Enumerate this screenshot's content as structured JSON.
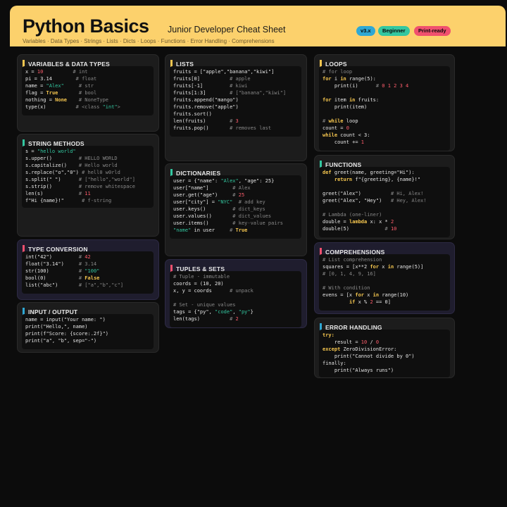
{
  "header": {
    "title": "Python Basics",
    "subtitle": "Junior Developer Cheat Sheet",
    "topics": "Variables · Data Types · Strings · Lists · Dicts · Loops · Functions · Error Handling · Comprehensions",
    "badges": [
      {
        "label": "v3.x",
        "color": "#2fa8d4"
      },
      {
        "label": "Beginner",
        "color": "#33c7a0"
      },
      {
        "label": "Print-ready",
        "color": "#f0506e"
      }
    ]
  },
  "colors": {
    "accent_yellow": "#f5c64f",
    "accent_green": "#33c7a0",
    "accent_pink": "#f0506e",
    "accent_blue": "#2fa8d4",
    "header_bg": "#fcd16c"
  },
  "cards": {
    "variables": {
      "title": "VARIABLES & DATA TYPES"
    },
    "strings": {
      "title": "STRING METHODS"
    },
    "conversion": {
      "title": "TYPE CONVERSION"
    },
    "io": {
      "title": "INPUT / OUTPUT"
    },
    "lists": {
      "title": "LISTS"
    },
    "dicts": {
      "title": "DICTIONARIES"
    },
    "tuples": {
      "title": "TUPLES & SETS"
    },
    "loops": {
      "title": "LOOPS"
    },
    "functions": {
      "title": "FUNCTIONS"
    },
    "comprehensions": {
      "title": "COMPREHENSIONS"
    },
    "errors": {
      "title": "ERROR HANDLING"
    }
  },
  "code": {
    "variables": [
      [
        [
          "x = ",
          ""
        ],
        [
          "10",
          "n"
        ],
        [
          "          ",
          ""
        ],
        [
          "# int",
          "c"
        ]
      ],
      [
        [
          "pi = 3.14        ",
          ""
        ],
        [
          "# float",
          "c"
        ]
      ],
      [
        [
          "name = ",
          ""
        ],
        [
          "\"Alex\"",
          "s"
        ],
        [
          "     ",
          ""
        ],
        [
          "# str",
          "c"
        ]
      ],
      [
        [
          "flag = ",
          ""
        ],
        [
          "True",
          "k"
        ],
        [
          "       ",
          ""
        ],
        [
          "# bool",
          "c"
        ]
      ],
      [
        [
          "nothing = ",
          ""
        ],
        [
          "None",
          "k"
        ],
        [
          "    ",
          ""
        ],
        [
          "# NoneType",
          "c"
        ]
      ],
      [
        [
          "type(x)          ",
          ""
        ],
        [
          "# <class ",
          "c"
        ],
        [
          "\"int\"",
          "s"
        ],
        [
          ">",
          "c"
        ]
      ]
    ],
    "strings": [
      [
        [
          "s = ",
          ""
        ],
        [
          "\"hello world\"",
          "s"
        ]
      ],
      [
        [
          "s.upper()         ",
          ""
        ],
        [
          "# HELLO WORLD",
          "c"
        ]
      ],
      [
        [
          "s.capitalize()    ",
          ""
        ],
        [
          "# Hello world",
          "c"
        ]
      ],
      [
        [
          "s.replace(\"o\",\"0\") ",
          ""
        ],
        [
          "# hell0 w0rld",
          "c"
        ]
      ],
      [
        [
          "s.split(\" \")      ",
          ""
        ],
        [
          "# [\"hello\",\"world\"]",
          "c"
        ]
      ],
      [
        [
          "s.strip()         ",
          ""
        ],
        [
          "# remove whitespace",
          "c"
        ]
      ],
      [
        [
          "len(s)            ",
          ""
        ],
        [
          "# ",
          "c"
        ],
        [
          "11",
          "n"
        ]
      ],
      [
        [
          "f\"Hi {name}!\"      ",
          ""
        ],
        [
          "# f-string",
          "c"
        ]
      ]
    ],
    "conversion": [
      [
        [
          "int(\"42\")         ",
          ""
        ],
        [
          "# ",
          "c"
        ],
        [
          "42",
          "n"
        ]
      ],
      [
        [
          "float(\"3.14\")     ",
          ""
        ],
        [
          "# 3.14",
          "c"
        ]
      ],
      [
        [
          "str(100)          ",
          ""
        ],
        [
          "# ",
          "c"
        ],
        [
          "\"100\"",
          "s"
        ]
      ],
      [
        [
          "bool(0)           ",
          ""
        ],
        [
          "# ",
          "c"
        ],
        [
          "False",
          "k"
        ]
      ],
      [
        [
          "list(\"abc\")       ",
          ""
        ],
        [
          "# [\"a\",\"b\",\"c\"]",
          "c"
        ]
      ]
    ],
    "io": [
      [
        [
          "name = input(\"Your name: \")",
          ""
        ]
      ],
      [
        [
          "print(\"Hello,\", name)",
          ""
        ]
      ],
      [
        [
          "print(f\"Score: {score:.2f}\")",
          ""
        ]
      ],
      [
        [
          "print(\"a\", \"b\", sep=\"-\")",
          ""
        ]
      ]
    ],
    "lists": [
      [
        [
          "fruits = [\"apple\",\"banana\",\"kiwi\"]",
          ""
        ]
      ],
      [
        [
          "fruits[0]          ",
          ""
        ],
        [
          "# apple",
          "c"
        ]
      ],
      [
        [
          "fruits[-1]         ",
          ""
        ],
        [
          "# kiwi",
          "c"
        ]
      ],
      [
        [
          "fruits[1:3]        ",
          ""
        ],
        [
          "# [\"banana\",\"kiwi\"]",
          "c"
        ]
      ],
      [
        [
          "fruits.append(\"mango\")",
          ""
        ]
      ],
      [
        [
          "fruits.remove(\"apple\")",
          ""
        ]
      ],
      [
        [
          "fruits.sort()",
          ""
        ]
      ],
      [
        [
          "len(fruits)        ",
          ""
        ],
        [
          "# ",
          "c"
        ],
        [
          "3",
          "n"
        ]
      ],
      [
        [
          "fruits.pop()       ",
          ""
        ],
        [
          "# removes last",
          "c"
        ]
      ]
    ],
    "dicts": [
      [
        [
          "user = {\"name\": ",
          ""
        ],
        [
          "\"Alex\"",
          "s"
        ],
        [
          ", \"age\": 25}",
          ""
        ]
      ],
      [
        [
          "user[\"name\"]        ",
          ""
        ],
        [
          "# Alex",
          "c"
        ]
      ],
      [
        [
          "user.get(\"age\")     ",
          ""
        ],
        [
          "# ",
          "c"
        ],
        [
          "25",
          "n"
        ]
      ],
      [
        [
          "user[\"city\"] = ",
          ""
        ],
        [
          "\"NYC\"",
          "s"
        ],
        [
          "  ",
          ""
        ],
        [
          "# add key",
          "c"
        ]
      ],
      [
        [
          "user.keys()         ",
          ""
        ],
        [
          "# dict_keys",
          "c"
        ]
      ],
      [
        [
          "user.values()       ",
          ""
        ],
        [
          "# dict_values",
          "c"
        ]
      ],
      [
        [
          "user.items()        ",
          ""
        ],
        [
          "# key-value pairs",
          "c"
        ]
      ],
      [
        [
          "\"name\"",
          "s"
        ],
        [
          " in user     ",
          ""
        ],
        [
          "# ",
          "c"
        ],
        [
          "True",
          "k"
        ]
      ]
    ],
    "tuples": [
      [
        [
          "# Tuple - immutable",
          "c"
        ]
      ],
      [
        [
          "coords = (10, 20)",
          ""
        ]
      ],
      [
        [
          "x, y = coords      ",
          ""
        ],
        [
          "# unpack",
          "c"
        ]
      ],
      [
        [
          "",
          ""
        ]
      ],
      [
        [
          "# Set - unique values",
          "c"
        ]
      ],
      [
        [
          "tags = {\"py\", ",
          ""
        ],
        [
          "\"code\"",
          "s"
        ],
        [
          ", ",
          ""
        ],
        [
          "\"py\"",
          "s"
        ],
        [
          "}",
          ""
        ]
      ],
      [
        [
          "len(tags)          ",
          ""
        ],
        [
          "# ",
          "c"
        ],
        [
          "2",
          "n"
        ]
      ]
    ],
    "loops": [
      [
        [
          "# for loop",
          "c"
        ]
      ],
      [
        [
          "for",
          "k"
        ],
        [
          " i ",
          ""
        ],
        [
          "in",
          "k"
        ],
        [
          " range(5):",
          ""
        ]
      ],
      [
        [
          "    print(i)      ",
          ""
        ],
        [
          "# ",
          "c"
        ],
        [
          "0 1 2 3 4",
          "n"
        ]
      ],
      [
        [
          "",
          ""
        ]
      ],
      [
        [
          "for",
          "k"
        ],
        [
          " item ",
          ""
        ],
        [
          "in",
          "k"
        ],
        [
          " fruits:",
          ""
        ]
      ],
      [
        [
          "    print(item)",
          ""
        ]
      ],
      [
        [
          "",
          ""
        ]
      ],
      [
        [
          "# ",
          "c"
        ],
        [
          "while",
          "k"
        ],
        [
          " loop",
          ""
        ]
      ],
      [
        [
          "count = ",
          ""
        ],
        [
          "0",
          "n"
        ]
      ],
      [
        [
          "while",
          "k"
        ],
        [
          " count < 3:",
          ""
        ]
      ],
      [
        [
          "    count += ",
          ""
        ],
        [
          "1",
          "n"
        ]
      ]
    ],
    "functions": [
      [
        [
          "def",
          "k"
        ],
        [
          " greet(name, greeting=\"Hi\"):",
          ""
        ]
      ],
      [
        [
          "    ",
          ""
        ],
        [
          "return",
          "k"
        ],
        [
          " f\"{greeting}, {name}!\"",
          ""
        ]
      ],
      [
        [
          "",
          ""
        ]
      ],
      [
        [
          "greet(\"Alex\")          ",
          ""
        ],
        [
          "# Hi, Alex!",
          "c"
        ]
      ],
      [
        [
          "greet(\"Alex\", \"Hey\")   ",
          ""
        ],
        [
          "# Hey, Alex!",
          "c"
        ]
      ],
      [
        [
          "",
          ""
        ]
      ],
      [
        [
          "# Lambda (one-liner)",
          "c"
        ]
      ],
      [
        [
          "double = ",
          ""
        ],
        [
          "lambda",
          "k"
        ],
        [
          " x: x * ",
          ""
        ],
        [
          "2",
          "n"
        ]
      ],
      [
        [
          "double(5)            ",
          ""
        ],
        [
          "# ",
          "c"
        ],
        [
          "10",
          "n"
        ]
      ]
    ],
    "comprehensions": [
      [
        [
          "# List comprehension",
          "c"
        ]
      ],
      [
        [
          "squares = [x**2 ",
          ""
        ],
        [
          "for",
          "k"
        ],
        [
          " x ",
          ""
        ],
        [
          "in",
          "k"
        ],
        [
          " range(5)]",
          ""
        ]
      ],
      [
        [
          "# [0, 1, 4, 9, 16]",
          "c"
        ]
      ],
      [
        [
          "",
          ""
        ]
      ],
      [
        [
          "# With condition",
          "c"
        ]
      ],
      [
        [
          "evens = [x ",
          ""
        ],
        [
          "for",
          "k"
        ],
        [
          " x ",
          ""
        ],
        [
          "in",
          "k"
        ],
        [
          " range(10)",
          ""
        ]
      ],
      [
        [
          "         ",
          ""
        ],
        [
          "if",
          "k"
        ],
        [
          " x % ",
          ""
        ],
        [
          "2",
          "n"
        ],
        [
          " == 0]",
          ""
        ]
      ]
    ],
    "errors": [
      [
        [
          "try:",
          "k"
        ]
      ],
      [
        [
          "    result = ",
          ""
        ],
        [
          "10",
          "n"
        ],
        [
          " / ",
          ""
        ],
        [
          "0",
          "n"
        ]
      ],
      [
        [
          "except",
          "k"
        ],
        [
          " ZeroDivisionError:",
          ""
        ]
      ],
      [
        [
          "    print(\"Cannot divide by 0\")",
          ""
        ]
      ],
      [
        [
          "finally:",
          ""
        ]
      ],
      [
        [
          "    print(\"Always runs\")",
          ""
        ]
      ]
    ]
  }
}
